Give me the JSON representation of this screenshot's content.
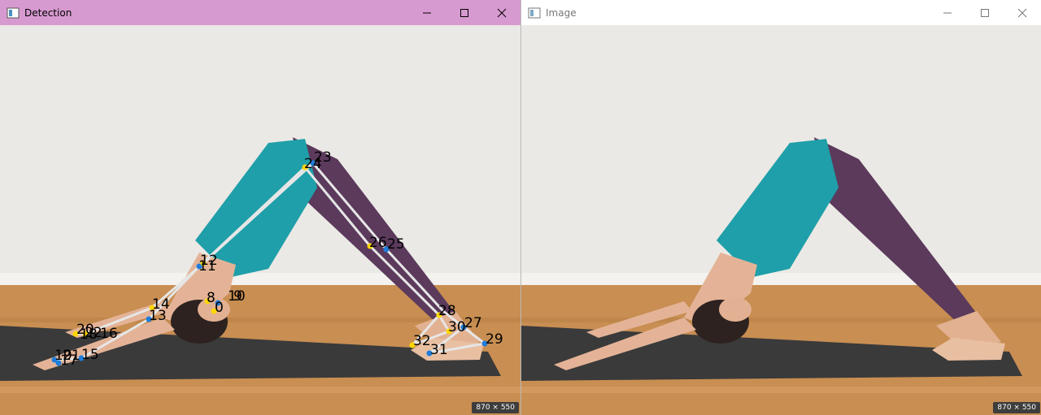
{
  "windows": {
    "detection": {
      "title": "Detection",
      "size_label": "870 × 550"
    },
    "image": {
      "title": "Image",
      "size_label": "870 × 550"
    }
  },
  "colors": {
    "detection_titlebar": "#d79ad0",
    "keypoint_left": "#ffd700",
    "keypoint_right": "#1e7ddc",
    "skeleton": "#e6e6e6",
    "label": "#000000"
  },
  "icons": [
    "app-icon",
    "minimize-icon",
    "maximize-icon",
    "close-icon"
  ],
  "keypoint_labels": [
    "23",
    "24",
    "25",
    "26",
    "27",
    "28",
    "29",
    "30",
    "31",
    "32",
    "12",
    "11",
    "14",
    "13",
    "16",
    "15",
    "20",
    "22",
    "18",
    "21",
    "19",
    "17",
    "10",
    "9",
    "8",
    "0"
  ]
}
